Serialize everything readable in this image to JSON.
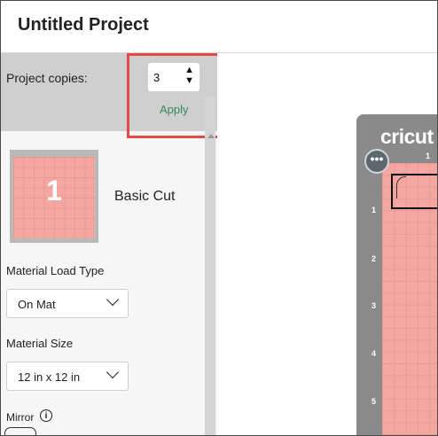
{
  "header": {
    "title": "Untitled Project"
  },
  "copies": {
    "label": "Project copies:",
    "value": "3",
    "apply_label": "Apply"
  },
  "mat": {
    "number": "1",
    "label": "Basic Cut"
  },
  "material_load": {
    "label": "Material Load Type",
    "value": "On Mat"
  },
  "material_size": {
    "label": "Material Size",
    "value": "12 in x 12 in"
  },
  "mirror": {
    "label": "Mirror",
    "info": "i"
  },
  "preview": {
    "brand": "cricut",
    "menu_icon": "more-dots-icon",
    "ruler_top": [
      "1"
    ],
    "ruler_left": [
      "1",
      "2",
      "3",
      "4",
      "5"
    ]
  },
  "colors": {
    "highlight": "#e24a4a",
    "apply": "#2f8a58",
    "mat": "#f4a7a0",
    "device": "#8a8a8a"
  }
}
